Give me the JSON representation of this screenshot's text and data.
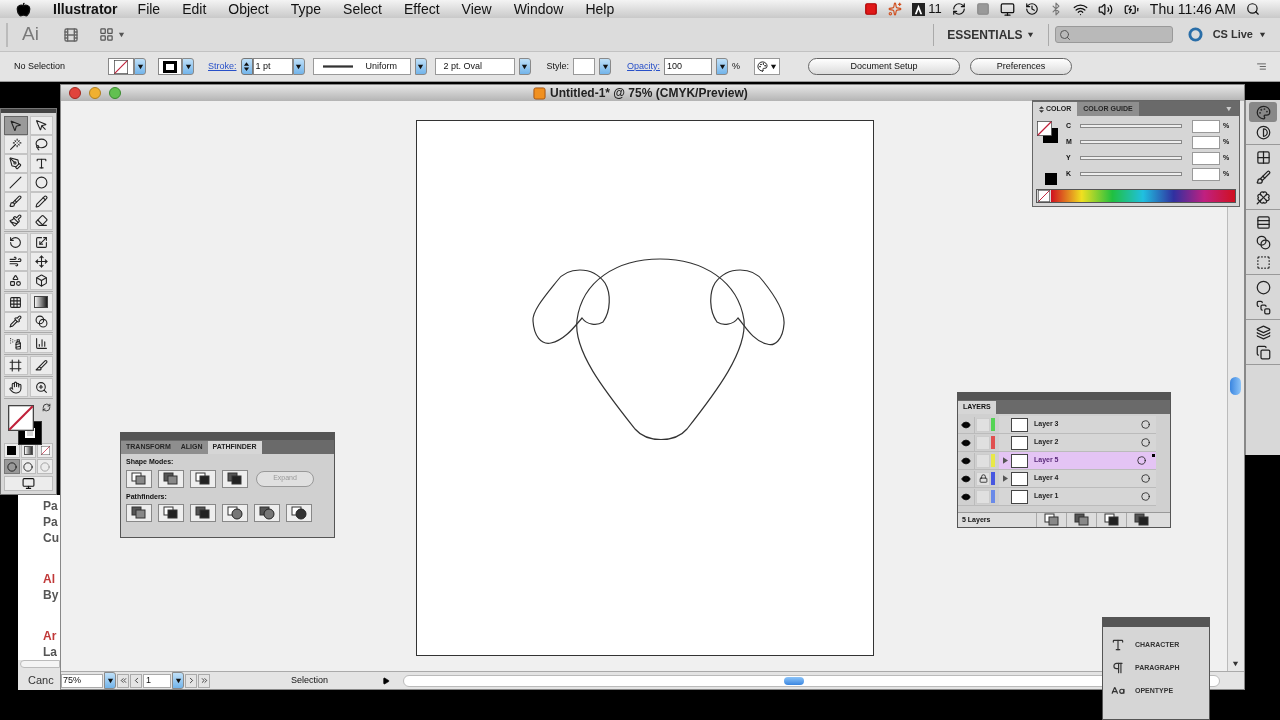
{
  "menu_bar": {
    "app_name": "Illustrator",
    "menus": [
      "File",
      "Edit",
      "Object",
      "Type",
      "Select",
      "Effect",
      "View",
      "Window",
      "Help"
    ],
    "adobe_count": "11",
    "clock": "Thu 11:46 AM"
  },
  "app_bar": {
    "logo": "Ai",
    "workspace": "ESSENTIALS",
    "cs_live": "CS Live"
  },
  "control_bar": {
    "selection": "No Selection",
    "stroke_label": "Stroke:",
    "stroke_weight": "1 pt",
    "profile": "Uniform",
    "brush": "2 pt. Oval",
    "style_label": "Style:",
    "opacity_label": "Opacity:",
    "opacity": "100",
    "percent": "%",
    "buttons": [
      "Document Setup",
      "Preferences"
    ]
  },
  "background_window": {
    "lines": [
      {
        "text": "Pa",
        "kind": "body"
      },
      {
        "text": "Pa",
        "kind": "body"
      },
      {
        "text": "Cu",
        "kind": "body"
      },
      {
        "text": "Al",
        "kind": "heading"
      },
      {
        "text": "By",
        "kind": "body"
      },
      {
        "text": "Ar",
        "kind": "heading"
      },
      {
        "text": "La",
        "kind": "body"
      },
      {
        "text": "Canc",
        "kind": "button"
      }
    ]
  },
  "document_window": {
    "title": "Untitled-1* @ 75% (CMYK/Preview)",
    "zoom": "75%",
    "artboard": "1",
    "status": "Selection"
  },
  "toolbox": {
    "tool_groups": [
      [
        {
          "kind": "selection",
          "selected": true
        },
        {
          "kind": "direct-selection",
          "selected": false
        },
        {
          "kind": "magic-wand",
          "selected": false
        },
        {
          "kind": "lasso",
          "selected": false
        },
        {
          "kind": "pen",
          "selected": false
        },
        {
          "kind": "type",
          "selected": false
        },
        {
          "kind": "line",
          "selected": false
        },
        {
          "kind": "ellipse",
          "selected": false
        },
        {
          "kind": "brush",
          "selected": false
        },
        {
          "kind": "pencil",
          "selected": false
        },
        {
          "kind": "blob-brush",
          "selected": false
        },
        {
          "kind": "eraser",
          "selected": false
        }
      ],
      [
        {
          "kind": "rotate",
          "selected": false
        },
        {
          "kind": "scale",
          "selected": false
        },
        {
          "kind": "warp",
          "selected": false
        },
        {
          "kind": "free-transform",
          "selected": false
        },
        {
          "kind": "shape-builder",
          "selected": false
        },
        {
          "kind": "perspective",
          "selected": false
        }
      ],
      [
        {
          "kind": "mesh",
          "selected": false
        },
        {
          "kind": "gradient",
          "selected": false
        },
        {
          "kind": "eyedropper",
          "selected": false
        },
        {
          "kind": "blend",
          "selected": false
        }
      ],
      [
        {
          "kind": "symbol-sprayer",
          "selected": false
        },
        {
          "kind": "graph",
          "selected": false
        }
      ],
      [
        {
          "kind": "artboard",
          "selected": false
        },
        {
          "kind": "slice",
          "selected": false
        }
      ],
      [
        {
          "kind": "hand",
          "selected": false
        },
        {
          "kind": "zoom",
          "selected": false
        }
      ]
    ]
  },
  "color_panel": {
    "tabs": [
      {
        "label": "COLOR",
        "selected": true
      },
      {
        "label": "COLOR GUIDE",
        "selected": false
      }
    ],
    "channels": [
      {
        "label": "C",
        "unit": "%"
      },
      {
        "label": "M",
        "unit": "%"
      },
      {
        "label": "Y",
        "unit": "%"
      },
      {
        "label": "K",
        "unit": "%"
      }
    ]
  },
  "dock": {
    "groups": [
      [
        {
          "kind": "color",
          "selected": true
        },
        {
          "kind": "color-guide",
          "selected": false
        }
      ],
      [
        {
          "kind": "swatches",
          "selected": false
        },
        {
          "kind": "brushes",
          "selected": false
        },
        {
          "kind": "symbols",
          "selected": false
        }
      ],
      [
        {
          "kind": "stroke",
          "selected": false
        },
        {
          "kind": "gradient",
          "selected": false
        },
        {
          "kind": "transparency",
          "selected": false
        }
      ],
      [
        {
          "kind": "appearance",
          "selected": false
        },
        {
          "kind": "graphic-styles",
          "selected": false
        }
      ],
      [
        {
          "kind": "layers",
          "selected": false
        },
        {
          "kind": "artboards",
          "selected": false
        }
      ]
    ]
  },
  "layers_panel": {
    "tab": "LAYERS",
    "layers": [
      {
        "name": "Layer 3",
        "color": "#55d455",
        "visible": true,
        "locked": false,
        "expandable": false,
        "selected": false
      },
      {
        "name": "Layer 2",
        "color": "#e05050",
        "visible": true,
        "locked": false,
        "expandable": false,
        "selected": false
      },
      {
        "name": "Layer 5",
        "color": "#e8e848",
        "visible": true,
        "locked": false,
        "expandable": true,
        "selected": true
      },
      {
        "name": "Layer 4",
        "color": "#4858e0",
        "visible": true,
        "locked": true,
        "expandable": true,
        "selected": false
      },
      {
        "name": "Layer 1",
        "color": "#6a8ae8",
        "visible": true,
        "locked": false,
        "expandable": false,
        "selected": false
      }
    ],
    "count": "5 Layers"
  },
  "pathfinder_panel": {
    "tabs": [
      {
        "label": "TRANSFORM",
        "selected": false
      },
      {
        "label": "ALIGN",
        "selected": false
      },
      {
        "label": "PATHFINDER",
        "selected": true
      }
    ],
    "shape_modes_label": "Shape Modes:",
    "expand": {
      "label": "Expand",
      "disabled": true
    },
    "pathfinders_label": "Pathfinders:"
  },
  "character_panel": {
    "items": [
      {
        "label": "CHARACTER",
        "kind": "character"
      },
      {
        "label": "PARAGRAPH",
        "kind": "paragraph"
      },
      {
        "label": "OPENTYPE",
        "kind": "opentype"
      }
    ]
  }
}
